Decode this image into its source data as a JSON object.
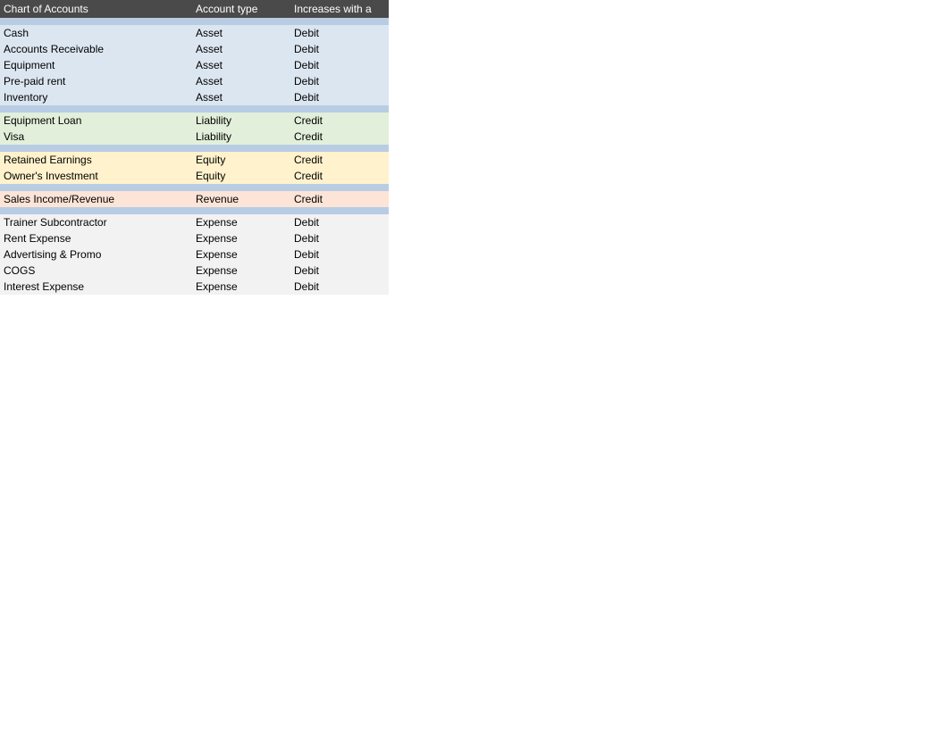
{
  "header": {
    "col1": "Chart of Accounts",
    "col2": "Account type",
    "col3": "Increases with a"
  },
  "rows": [
    {
      "id": "header-spacer",
      "type": "separator"
    },
    {
      "id": "cash",
      "account": "Cash",
      "accountType": "Asset",
      "increases": "Debit",
      "rowClass": "asset-row"
    },
    {
      "id": "accounts-receivable",
      "account": "Accounts Receivable",
      "accountType": "Asset",
      "increases": "Debit",
      "rowClass": "asset-row"
    },
    {
      "id": "equipment",
      "account": "Equipment",
      "accountType": "Asset",
      "increases": "Debit",
      "rowClass": "asset-row"
    },
    {
      "id": "pre-paid-rent",
      "account": "Pre-paid rent",
      "accountType": "Asset",
      "increases": "Debit",
      "rowClass": "asset-row"
    },
    {
      "id": "inventory",
      "account": "Inventory",
      "accountType": "Asset",
      "increases": "Debit",
      "rowClass": "asset-row"
    },
    {
      "id": "sep1",
      "type": "separator"
    },
    {
      "id": "equipment-loan",
      "account": "Equipment Loan",
      "accountType": "Liability",
      "increases": "Credit",
      "rowClass": "liability-row"
    },
    {
      "id": "visa",
      "account": "Visa",
      "accountType": "Liability",
      "increases": "Credit",
      "rowClass": "liability-row"
    },
    {
      "id": "sep2",
      "type": "separator"
    },
    {
      "id": "retained-earnings",
      "account": "Retained Earnings",
      "accountType": "Equity",
      "increases": "Credit",
      "rowClass": "equity-row"
    },
    {
      "id": "owners-investment",
      "account": "Owner's Investment",
      "accountType": "Equity",
      "increases": "Credit",
      "rowClass": "equity-row"
    },
    {
      "id": "sep3",
      "type": "separator"
    },
    {
      "id": "sales-income",
      "account": "Sales Income/Revenue",
      "accountType": "Revenue",
      "increases": "Credit",
      "rowClass": "revenue-row"
    },
    {
      "id": "sep4",
      "type": "separator"
    },
    {
      "id": "trainer-sub",
      "account": "Trainer Subcontractor",
      "accountType": "Expense",
      "increases": "Debit",
      "rowClass": "expense-row"
    },
    {
      "id": "rent-expense",
      "account": "Rent Expense",
      "accountType": "Expense",
      "increases": "Debit",
      "rowClass": "expense-row"
    },
    {
      "id": "advertising",
      "account": "Advertising & Promo",
      "accountType": "Expense",
      "increases": "Debit",
      "rowClass": "expense-row"
    },
    {
      "id": "cogs",
      "account": "COGS",
      "accountType": "Expense",
      "increases": "Debit",
      "rowClass": "expense-row"
    },
    {
      "id": "interest-expense",
      "account": "Interest Expense",
      "accountType": "Expense",
      "increases": "Debit",
      "rowClass": "expense-row"
    }
  ]
}
